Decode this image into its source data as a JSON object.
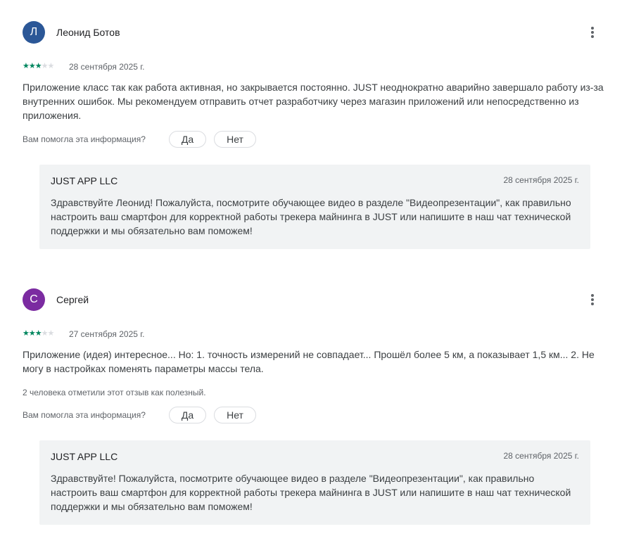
{
  "colors": {
    "star_filled": "#01875f",
    "star_empty": "#dadce0",
    "secondary_text": "#5f6368",
    "reply_background": "#f1f3f4"
  },
  "reviews": [
    {
      "avatar_letter": "Л",
      "avatar_color": "#2b5797",
      "author": "Леонид Ботов",
      "more_icon": "more-vert-icon",
      "rating": 3,
      "rating_max": 5,
      "date": "28 сентября 2025 г.",
      "text": "Приложение класс так как работа активная, но закрывается постоянно. JUST неоднократно аварийно завершало работу из-за внутренних ошибок. Мы рекомендуем отправить отчет разработчику через магазин приложений или непосредственно из приложения.",
      "helpful_count_text": "",
      "helpful_question": "Вам помогла эта информация?",
      "yes_label": "Да",
      "no_label": "Нет",
      "reply": {
        "author": "JUST APP LLC",
        "date": "28 сентября 2025 г.",
        "text": "Здравствуйте Леонид! Пожалуйста, посмотрите обучающее видео в разделе \"Видеопрезентации\", как правильно настроить ваш смартфон для корректной работы трекера майнинга в JUST или напишите в наш чат технической поддержки и мы обязательно вам поможем!"
      }
    },
    {
      "avatar_letter": "С",
      "avatar_color": "#7b2ba1",
      "author": "Сергей",
      "more_icon": "more-vert-icon",
      "rating": 3,
      "rating_max": 5,
      "date": "27 сентября 2025 г.",
      "text": "Приложение (идея) интересное... Но: 1. точность измерений не совпадает... Прошёл более 5 км, а показывает 1,5 км... 2. Не могу в настройках поменять параметры массы тела.",
      "helpful_count_text": "2 человека отметили этот отзыв как полезный.",
      "helpful_question": "Вам помогла эта информация?",
      "yes_label": "Да",
      "no_label": "Нет",
      "reply": {
        "author": "JUST APP LLC",
        "date": "28 сентября 2025 г.",
        "text": "Здравствуйте! Пожалуйста, посмотрите обучающее видео в разделе \"Видеопрезентации\", как правильно настроить ваш смартфон для корректной работы трекера майнинга в JUST или напишите в наш чат технической поддержки и мы обязательно вам поможем!"
      }
    }
  ]
}
